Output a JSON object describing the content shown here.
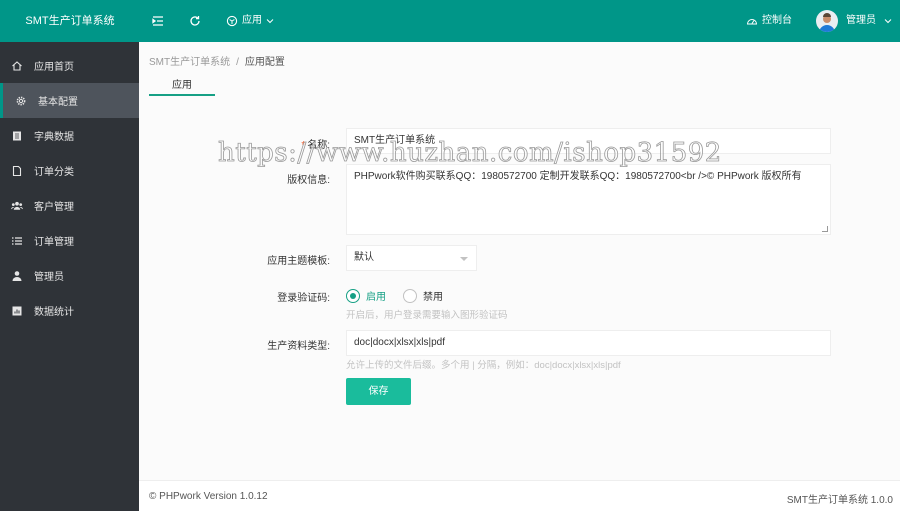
{
  "app": {
    "title": "SMT生产订单系统"
  },
  "header": {
    "menu_toggle_icon": "indent-icon",
    "refresh_icon": "refresh-icon",
    "app_menu": {
      "icon": "cube-icon",
      "label": "应用"
    },
    "console": {
      "icon": "dashboard-icon",
      "label": "控制台"
    },
    "user": {
      "name": "管理员"
    }
  },
  "sidebar": {
    "items": [
      {
        "label": "应用首页",
        "icon": "home-icon",
        "active": false
      },
      {
        "label": "基本配置",
        "icon": "gear-icon",
        "active": true
      },
      {
        "label": "字典数据",
        "icon": "book-icon",
        "active": false
      },
      {
        "label": "订单分类",
        "icon": "file-icon",
        "active": false
      },
      {
        "label": "客户管理",
        "icon": "users-icon",
        "active": false
      },
      {
        "label": "订单管理",
        "icon": "list-icon",
        "active": false
      },
      {
        "label": "管理员",
        "icon": "user-icon",
        "active": false
      },
      {
        "label": "数据统计",
        "icon": "chart-icon",
        "active": false
      }
    ]
  },
  "breadcrumb": {
    "root": "SMT生产订单系统",
    "separator": "/",
    "current": "应用配置"
  },
  "tabs": [
    {
      "label": "应用",
      "active": true
    }
  ],
  "form": {
    "name": {
      "label": "名称:",
      "required_mark": "*",
      "value": "SMT生产订单系统"
    },
    "copyright": {
      "label": "版权信息:",
      "value": "PHPwork软件购买联系QQ：1980572700 定制开发联系QQ：1980572700<br />© PHPwork 版权所有"
    },
    "theme": {
      "label": "应用主题模板:",
      "selected": "默认"
    },
    "captcha": {
      "label": "登录验证码:",
      "options": [
        {
          "label": "启用",
          "checked": true
        },
        {
          "label": "禁用",
          "checked": false
        }
      ],
      "hint": "开启后，用户登录需要输入图形验证码"
    },
    "file_types": {
      "label": "生产资料类型:",
      "value": "doc|docx|xlsx|xls|pdf",
      "hint": "允许上传的文件后缀。多个用 | 分隔，例如：doc|docx|xlsx|xls|pdf"
    },
    "save_label": "保存"
  },
  "watermark": "https://www.huzhan.com/ishop31592",
  "footer": {
    "left": "© PHPwork Version 1.0.12",
    "right": "SMT生产订单系统 1.0.0"
  },
  "colors": {
    "header": "#009688",
    "sidebar": "#2f3338",
    "accent": "#16a085",
    "button": "#1abc9c"
  }
}
